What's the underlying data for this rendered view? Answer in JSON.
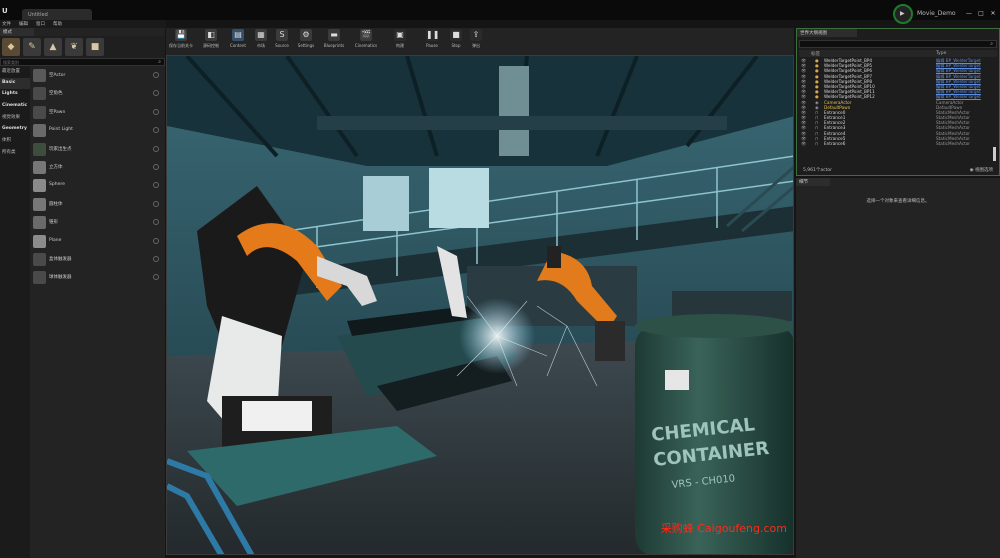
{
  "window": {
    "logo": "U",
    "doc_tab": "Untitled",
    "project_name": "Movie_Demo",
    "project_icon": "▶",
    "controls": [
      "—",
      "□",
      "✕"
    ]
  },
  "menu": [
    "文件",
    "编辑",
    "窗口",
    "帮助"
  ],
  "modes": {
    "tab_label": "模式",
    "tools": [
      {
        "icon": "place-mode-icon",
        "glyph": "◆",
        "active": true
      },
      {
        "icon": "paint-mode-icon",
        "glyph": "✎",
        "active": false
      },
      {
        "icon": "landscape-mode-icon",
        "glyph": "▲",
        "active": false
      },
      {
        "icon": "foliage-mode-icon",
        "glyph": "❦",
        "active": false
      },
      {
        "icon": "geometry-mode-icon",
        "glyph": "■",
        "active": false
      }
    ],
    "search_placeholder": "搜索类别",
    "categories": [
      {
        "label": "最近放置",
        "bold": false,
        "selected": false
      },
      {
        "label": "Basic",
        "bold": true,
        "selected": true
      },
      {
        "label": "Lights",
        "bold": true,
        "selected": false
      },
      {
        "label": "Cinematic",
        "bold": true,
        "selected": false
      },
      {
        "label": "视觉效果",
        "bold": false,
        "selected": false
      },
      {
        "label": "Geometry",
        "bold": true,
        "selected": false
      },
      {
        "label": "体积",
        "bold": false,
        "selected": false
      },
      {
        "label": "所有类",
        "bold": false,
        "selected": false
      }
    ],
    "items": [
      {
        "label": "空Actor",
        "thumb": "#5a5a5a"
      },
      {
        "label": "空角色",
        "thumb": "#4a4a4a"
      },
      {
        "label": "空Pawn",
        "thumb": "#4a4a4a"
      },
      {
        "label": "Point Light",
        "thumb": "#6a6a6a"
      },
      {
        "label": "玩家出生点",
        "thumb": "#3e4e3e"
      },
      {
        "label": "立方体",
        "thumb": "#777777"
      },
      {
        "label": "Sphere",
        "thumb": "#8a8a8a"
      },
      {
        "label": "圆柱体",
        "thumb": "#777777"
      },
      {
        "label": "锥形",
        "thumb": "#6a6a6a"
      },
      {
        "label": "Plane",
        "thumb": "#8c8c8c"
      },
      {
        "label": "盒体触发器",
        "thumb": "#4a4a4a"
      },
      {
        "label": "球体触发器",
        "thumb": "#4a4a4a"
      }
    ]
  },
  "toolbar": {
    "buttons": [
      {
        "label": "保存当前关卡",
        "glyph": "💾",
        "icon": "save-icon",
        "color": "#3b3b3b"
      },
      {
        "label": "源码控制",
        "glyph": "◧",
        "icon": "source-control-icon",
        "color": "#3b3b3b"
      },
      {
        "label": "Content",
        "glyph": "▤",
        "icon": "content-icon",
        "color": "#35506a"
      },
      {
        "label": "市场",
        "glyph": "▦",
        "icon": "marketplace-icon",
        "color": "#3b3b3b"
      },
      {
        "label": "Source",
        "glyph": "S",
        "icon": "source-icon",
        "color": "#3b3b3b"
      },
      {
        "label": "Settings",
        "glyph": "⚙",
        "icon": "settings-icon",
        "color": "#3b3b3b"
      },
      {
        "label": "Blueprints",
        "glyph": "▬",
        "icon": "blueprints-icon",
        "color": "#3b3b3b"
      },
      {
        "label": "Cinematics",
        "glyph": "🎬",
        "icon": "cinematics-icon",
        "color": "#3b3b3b"
      },
      {
        "label": "构建",
        "glyph": "▣",
        "icon": "build-icon",
        "color": "#2b2b2b"
      },
      {
        "label": "Pause",
        "glyph": "❚❚",
        "icon": "pause-icon",
        "color": "#2b2b2b"
      },
      {
        "label": "Stop",
        "glyph": "■",
        "icon": "stop-icon",
        "color": "#2b2b2b"
      },
      {
        "label": "弹出",
        "glyph": "⇪",
        "icon": "eject-icon",
        "color": "#2b2b2b"
      }
    ]
  },
  "viewport": {
    "watermark": "采购蜂 Caigoufeng.com"
  },
  "outliner": {
    "tab_label": "世界大纲视图",
    "search_placeholder": "搜索...",
    "col_label": "标签",
    "col_type": "Type",
    "rows": [
      {
        "name": "WelderTargetPoint_BP4",
        "type": "编辑 BP_WelderTarget",
        "link": true,
        "highlight": false
      },
      {
        "name": "WelderTargetPoint_BP5",
        "type": "编辑 BP_WelderTarget",
        "link": true,
        "highlight": false
      },
      {
        "name": "WelderTargetPoint_BP6",
        "type": "编辑 BP_WelderTarget",
        "link": true,
        "highlight": false
      },
      {
        "name": "WelderTargetPoint_BP7",
        "type": "编辑 BP_WelderTarget",
        "link": true,
        "highlight": false
      },
      {
        "name": "WelderTargetPoint_BP8",
        "type": "编辑 BP_WelderTarget",
        "link": true,
        "highlight": false
      },
      {
        "name": "WelderTargetPoint_BP10",
        "type": "编辑 BP_WelderTarget",
        "link": true,
        "highlight": false
      },
      {
        "name": "WelderTargetPoint_BP11",
        "type": "编辑 BP_WelderTarget",
        "link": true,
        "highlight": false
      },
      {
        "name": "WelderTargetPoint_BP12",
        "type": "编辑 BP_WelderTarget",
        "link": true,
        "highlight": false
      },
      {
        "name": "CameraActor",
        "type": "CameraActor",
        "link": false,
        "highlight": true
      },
      {
        "name": "DefaultPawn",
        "type": "DefaultPawn",
        "link": false,
        "highlight": true
      },
      {
        "name": "Entrance0",
        "type": "StaticMeshActor",
        "link": false,
        "highlight": false
      },
      {
        "name": "Entrance1",
        "type": "StaticMeshActor",
        "link": false,
        "highlight": false
      },
      {
        "name": "Entrance2",
        "type": "StaticMeshActor",
        "link": false,
        "highlight": false
      },
      {
        "name": "Entrance3",
        "type": "StaticMeshActor",
        "link": false,
        "highlight": false
      },
      {
        "name": "Entrance4",
        "type": "StaticMeshActor",
        "link": false,
        "highlight": false
      },
      {
        "name": "Entrance5",
        "type": "StaticMeshActor",
        "link": false,
        "highlight": false
      },
      {
        "name": "Entrance6",
        "type": "StaticMeshActor",
        "link": false,
        "highlight": false
      }
    ],
    "count": "5,961个actor",
    "view_options": "视图选项"
  },
  "details": {
    "tab_label": "细节",
    "empty_message": "选择一个对象来查看详细信息。"
  }
}
